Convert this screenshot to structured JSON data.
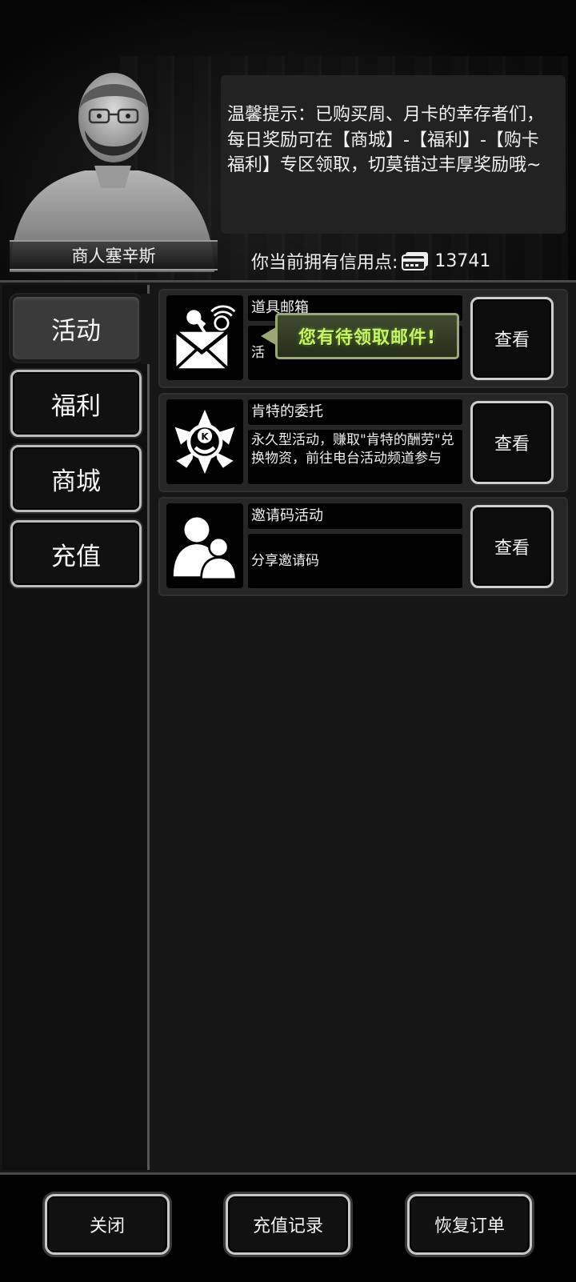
{
  "npc": {
    "name": "商人塞辛斯"
  },
  "tip": {
    "text": "温馨提示：已购买周、月卡的幸存者们，每日奖励可在【商城】-【福利】-【购卡福利】专区领取，切莫错过丰厚奖励哦~"
  },
  "credits": {
    "label": "你当前拥有信用点:",
    "value": "13741",
    "icon": "credit-card-icon"
  },
  "tabs": [
    {
      "label": "活动",
      "active": true
    },
    {
      "label": "福利",
      "active": false
    },
    {
      "label": "商城",
      "active": false
    },
    {
      "label": "充值",
      "active": false
    }
  ],
  "rows": [
    {
      "title": "道具邮箱",
      "desc": "活",
      "button": "查看",
      "icon": "mail-pin-icon",
      "badge": "您有待领取邮件!"
    },
    {
      "title": "肯特的委托",
      "desc": "永久型活动，赚取\"肯特的酬劳\"兑换物资，前往电台活动频道参与",
      "button": "查看",
      "icon": "kent-emblem-icon"
    },
    {
      "title": "邀请码活动",
      "desc": "分享邀请码",
      "button": "查看",
      "icon": "users-icon"
    }
  ],
  "footer": {
    "close": "关闭",
    "recharge_history": "充值记录",
    "restore_order": "恢复订单"
  },
  "colors": {
    "badge_text": "#c7f26a",
    "badge_border": "#9aa877",
    "button_border": "#cfcfcf"
  }
}
